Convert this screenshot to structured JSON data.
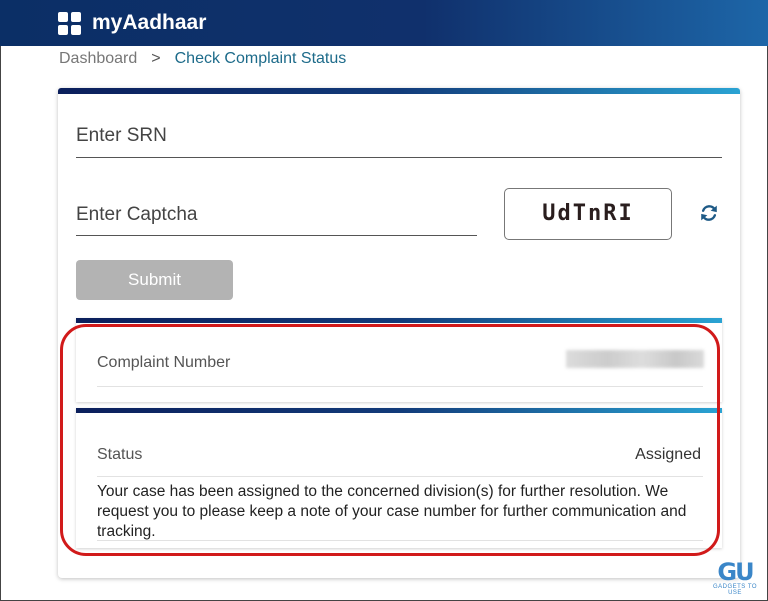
{
  "header": {
    "app_title": "myAadhaar",
    "logo_icon": "grid-logo-icon"
  },
  "breadcrumb": {
    "items": [
      "Dashboard",
      "Check Complaint Status"
    ],
    "separator": ">"
  },
  "form": {
    "srn_label": "Enter SRN",
    "captcha_label": "Enter Captcha",
    "captcha_text": "UdTnRI",
    "refresh_icon": "refresh-icon",
    "submit_label": "Submit"
  },
  "result": {
    "complaint_label": "Complaint Number",
    "status_label": "Status",
    "status_value": "Assigned",
    "description": "Your case has been assigned to the concerned division(s) for further resolution. We request you to please keep a note of your case number for further communication and tracking."
  },
  "watermark": {
    "logo": "GU",
    "sub": "GADGETS TO USE"
  },
  "colors": {
    "header_bg": "#10306c",
    "accent_link": "#1d6b8a",
    "highlight": "#d11a1a",
    "submit_disabled": "#b3b3b3"
  }
}
